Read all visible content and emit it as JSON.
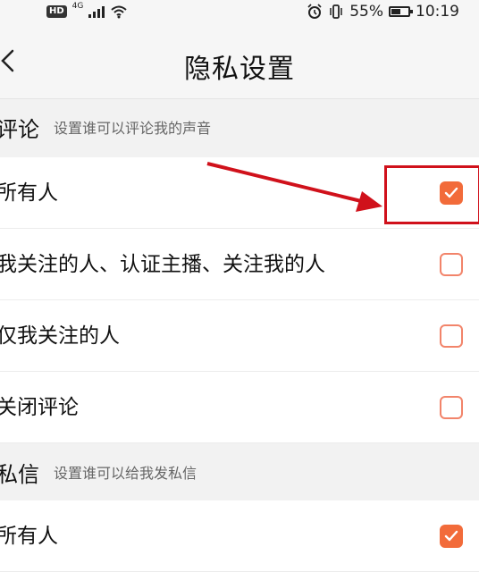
{
  "status_bar": {
    "hd": "HD",
    "network": "4G",
    "battery_text": "55%",
    "battery_level": 0.55,
    "time": "10:19"
  },
  "nav": {
    "title": "隐私设置"
  },
  "comment_section": {
    "title": "评论",
    "description": "设置谁可以评论我的声音",
    "options": [
      {
        "label": "所有人",
        "checked": true
      },
      {
        "label": "我关注的人、认证主播、关注我的人",
        "checked": false
      },
      {
        "label": "仅我关注的人",
        "checked": false
      },
      {
        "label": "关闭评论",
        "checked": false
      }
    ]
  },
  "message_section": {
    "title": "私信",
    "description": "设置谁可以给我发私信",
    "options": [
      {
        "label": "所有人",
        "checked": true
      }
    ]
  },
  "colors": {
    "accent": "#f26b3a",
    "annotation": "#d0111b"
  }
}
